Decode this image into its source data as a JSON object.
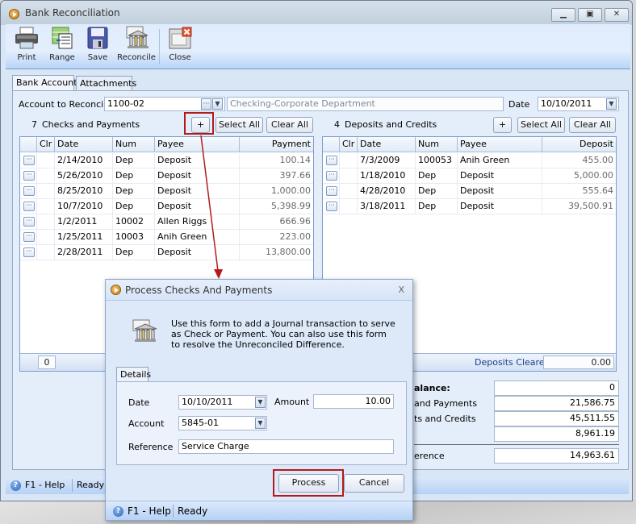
{
  "window": {
    "title": "Bank Reconciliation",
    "controls": {
      "minimize": "minimize",
      "restore": "restore",
      "close": "close"
    }
  },
  "toolbar": {
    "items": [
      {
        "label": "Print",
        "icon": "printer-icon"
      },
      {
        "label": "Range",
        "icon": "range-icon"
      },
      {
        "label": "Save",
        "icon": "floppy-disk-icon"
      },
      {
        "label": "Reconcile",
        "icon": "bank-icon"
      },
      {
        "label": "Close",
        "icon": "close-window-icon"
      }
    ]
  },
  "tabs": [
    {
      "label": "Bank Accounts",
      "active": true
    },
    {
      "label": "Attachments",
      "active": false
    }
  ],
  "form": {
    "account_label": "Account to Reconcile",
    "account_value": "1100-02",
    "account_description": "Checking-Corporate Department",
    "date_label": "Date",
    "date_value": "10/10/2011"
  },
  "checks": {
    "count": "7",
    "title": "Checks and Payments",
    "add_label": "+",
    "select_all_label": "Select All",
    "clear_all_label": "Clear All",
    "columns": [
      "",
      "Clr",
      "Date",
      "Num",
      "Payee",
      "Payment"
    ],
    "rows": [
      {
        "date": "2/14/2010",
        "num": "Dep",
        "payee": "Deposit",
        "amount": "100.14"
      },
      {
        "date": "5/26/2010",
        "num": "Dep",
        "payee": "Deposit",
        "amount": "397.66"
      },
      {
        "date": "8/25/2010",
        "num": "Dep",
        "payee": "Deposit",
        "amount": "1,000.00"
      },
      {
        "date": "10/7/2010",
        "num": "Dep",
        "payee": "Deposit",
        "amount": "5,398.99"
      },
      {
        "date": "1/2/2011",
        "num": "10002",
        "payee": "Allen Riggs",
        "amount": "666.96"
      },
      {
        "date": "1/25/2011",
        "num": "10003",
        "payee": "Anih Green",
        "amount": "223.00"
      },
      {
        "date": "2/28/2011",
        "num": "Dep",
        "payee": "Deposit",
        "amount": "13,800.00"
      }
    ],
    "footer_count": "0"
  },
  "deposits": {
    "count": "4",
    "title": "Deposits and Credits",
    "add_label": "+",
    "select_all_label": "Select All",
    "clear_all_label": "Clear All",
    "columns": [
      "",
      "Clr",
      "Date",
      "Num",
      "Payee",
      "Deposit"
    ],
    "rows": [
      {
        "date": "7/3/2009",
        "num": "100053",
        "payee": "Anih Green",
        "amount": "455.00"
      },
      {
        "date": "1/18/2010",
        "num": "Dep",
        "payee": "Deposit",
        "amount": "5,000.00"
      },
      {
        "date": "4/28/2010",
        "num": "Dep",
        "payee": "Deposit",
        "amount": "555.64"
      },
      {
        "date": "3/18/2011",
        "num": "Dep",
        "payee": "Deposit",
        "amount": "39,500.91"
      }
    ],
    "footer_label": "Deposits Cleared",
    "footer_value": "0.00"
  },
  "summary": {
    "rows": [
      {
        "label": "alance:",
        "value": "0"
      },
      {
        "label": " and Payments",
        "value": "21,586.75"
      },
      {
        "label": "ts and Credits",
        "value": "45,511.55"
      },
      {
        "label": "",
        "value": "8,961.19"
      },
      {
        "label": "erence",
        "value": "14,963.61"
      }
    ]
  },
  "status": {
    "help": "F1 - Help",
    "state": "Ready"
  },
  "dialog": {
    "title": "Process Checks And Payments",
    "close": "X",
    "description": "Use this form to add a Journal transaction to serve as Check or Payment. You can also use this form to resolve the Unreconciled Difference.",
    "tab": "Details",
    "date_label": "Date",
    "date_value": "10/10/2011",
    "amount_label": "Amount",
    "amount_value": "10.00",
    "account_label": "Account",
    "account_value": "5845-01",
    "reference_label": "Reference",
    "reference_value": "Service Charge",
    "process_label": "Process",
    "cancel_label": "Cancel",
    "status_help": "F1 - Help",
    "status_state": "Ready"
  },
  "annotation_color": "#b31b1b"
}
